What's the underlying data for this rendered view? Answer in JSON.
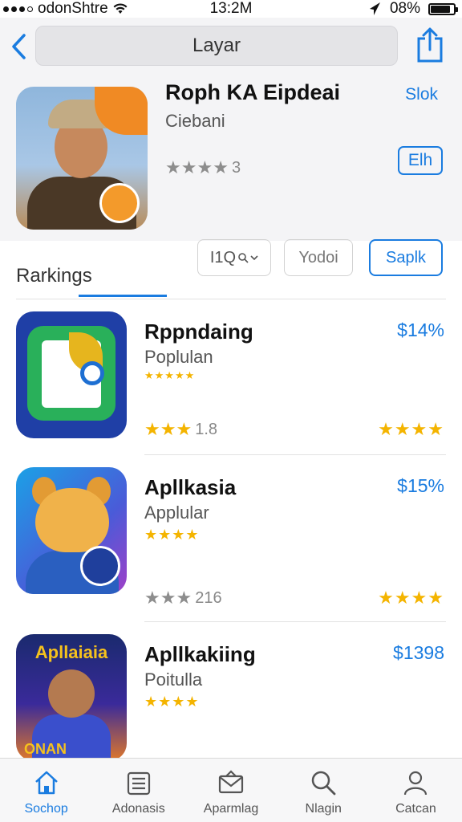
{
  "status_bar": {
    "carrier": "odonShtre",
    "time": "13:2M",
    "battery": "08%",
    "battery_level": 0.85
  },
  "nav": {
    "search_text": "Layar"
  },
  "featured": {
    "title": "Roph KA Eipdeai",
    "subtitle": "Ciebani",
    "rating_text": "3",
    "stars_filled": 3,
    "link_label": "Slok",
    "button_label": "Elh"
  },
  "rankings": {
    "label": "Rarkings",
    "segments": [
      "I1Q",
      "Yodoi",
      "Saplk"
    ]
  },
  "apps": [
    {
      "name": "Rppndaing",
      "category": "Poplulan",
      "price": "$14%",
      "rating_text": "1.8",
      "stars_filled": 3,
      "right_stars": "★★★★"
    },
    {
      "name": "Apllkasia",
      "category": "Applular",
      "price": "$15%",
      "rating_text": "216",
      "stars_filled": 3,
      "right_stars": "★★★★"
    },
    {
      "name": "Apllkakiing",
      "category": "Poitulla",
      "price": "$1398",
      "icon_title": "Apllaiaia",
      "icon_bottom": "ONAN"
    }
  ],
  "tabs": [
    {
      "label": "Sochop",
      "icon": "home-icon"
    },
    {
      "label": "Adonasis",
      "icon": "list-icon"
    },
    {
      "label": "Aparmlag",
      "icon": "mail-icon"
    },
    {
      "label": "Nlagin",
      "icon": "search-icon"
    },
    {
      "label": "Catcan",
      "icon": "person-icon"
    }
  ],
  "colors": {
    "accent": "#1a7ce0",
    "star": "#f4b400"
  }
}
